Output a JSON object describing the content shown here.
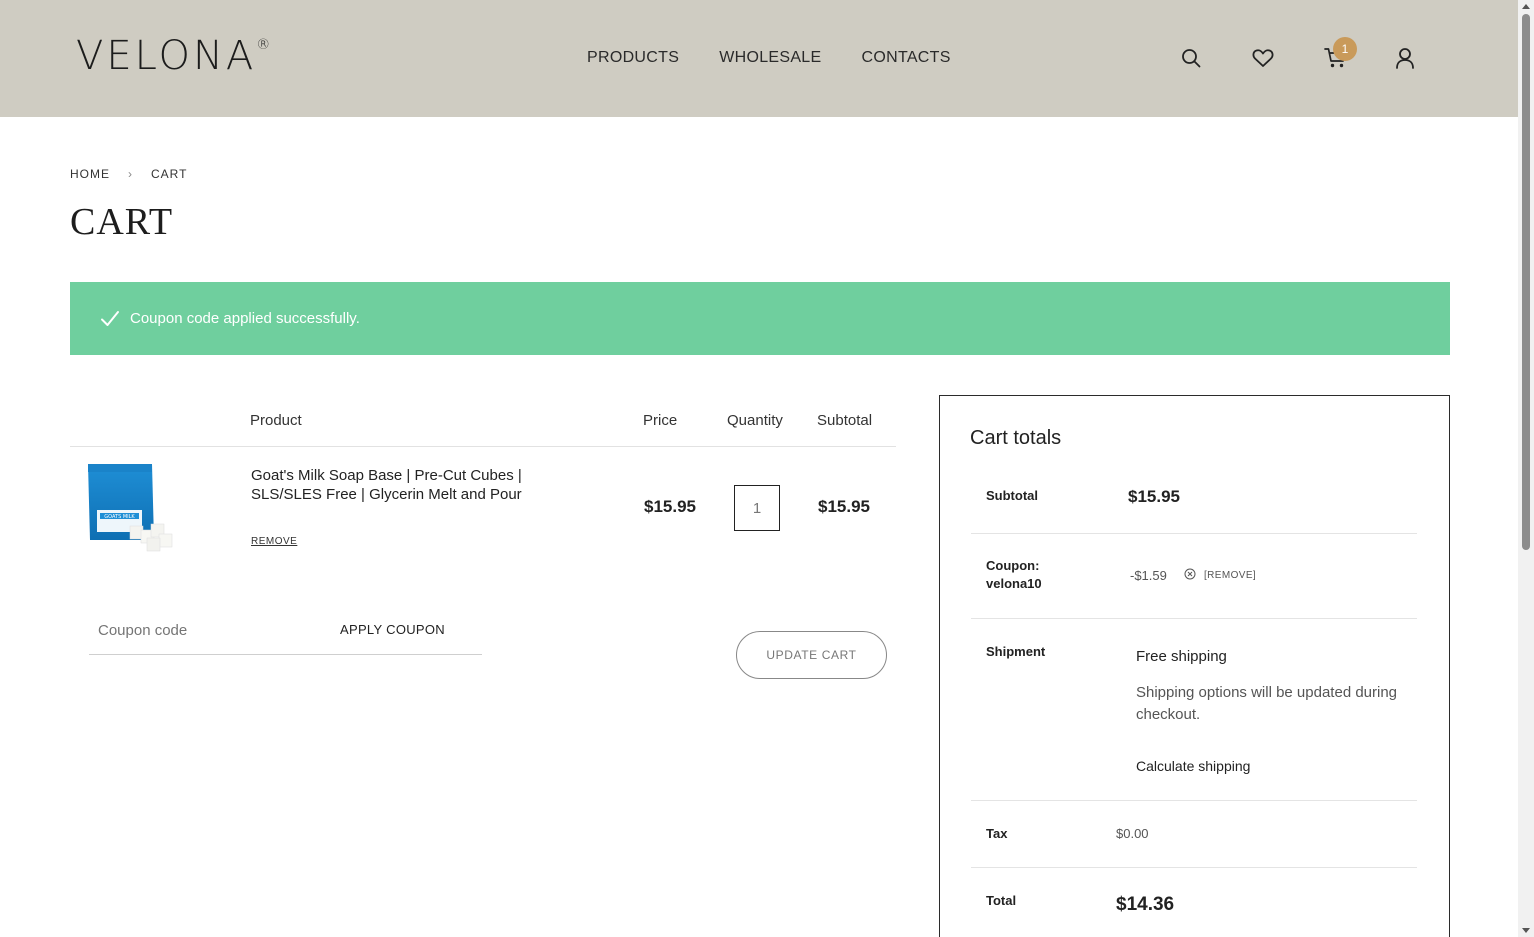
{
  "header": {
    "logo": "VELONA",
    "logo_mark": "®",
    "nav": [
      "PRODUCTS",
      "WHOLESALE",
      "CONTACTS"
    ],
    "cart_count": "1",
    "icons": [
      "search-icon",
      "heart-icon",
      "cart-icon",
      "user-icon"
    ],
    "bg_color": "#cfccc2",
    "badge_color": "#c99a5a"
  },
  "breadcrumb": {
    "home": "HOME",
    "current": "CART"
  },
  "page_title": "CART",
  "notice": {
    "message": "Coupon code applied successfully.",
    "color": "#6fcf9e"
  },
  "cart_table": {
    "headers": {
      "product": "Product",
      "price": "Price",
      "quantity": "Quantity",
      "subtotal": "Subtotal"
    },
    "items": [
      {
        "name": "Goat's Milk Soap Base | Pre-Cut Cubes | SLS/SLES Free | Glycerin Melt and Pour",
        "remove": "REMOVE",
        "price": "$15.95",
        "quantity": "1",
        "subtotal": "$15.95",
        "image_label": "GOATS MILK"
      }
    ]
  },
  "coupon": {
    "placeholder": "Coupon code",
    "apply": "APPLY COUPON"
  },
  "update_cart": "UPDATE CART",
  "totals": {
    "title": "Cart totals",
    "subtotal_label": "Subtotal",
    "subtotal": "$15.95",
    "coupon_label": "Coupon: velona10",
    "coupon_amount": "-$1.59",
    "coupon_remove": "[REMOVE]",
    "shipment_label": "Shipment",
    "shipment_method": "Free shipping",
    "shipment_note": "Shipping options will be updated during checkout.",
    "calculate": "Calculate shipping",
    "tax_label": "Tax",
    "tax": "$0.00",
    "total_label": "Total",
    "total": "$14.36"
  }
}
